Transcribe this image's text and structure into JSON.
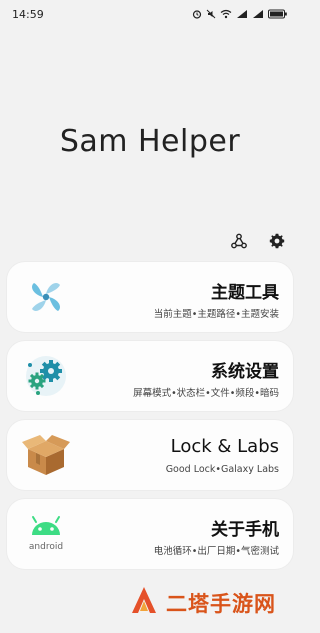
{
  "status_bar": {
    "time": "14:59",
    "battery": "100"
  },
  "app": {
    "title": "Sam Helper"
  },
  "actions": {
    "graph_icon": "share-graph-icon",
    "settings_icon": "gear-icon"
  },
  "cards": [
    {
      "title": "主题工具",
      "subtitle": "当前主题•主题路径•主题安装",
      "icon": "fan-icon"
    },
    {
      "title": "系统设置",
      "subtitle": "屏幕模式•状态栏•文件•频段•暗码",
      "icon": "gears-icon"
    },
    {
      "title": "Lock & Labs",
      "subtitle": "Good Lock•Galaxy Labs",
      "icon": "box-icon"
    },
    {
      "title": "关于手机",
      "subtitle": "电池循环•出厂日期•气密测试",
      "icon": "android-icon",
      "icon_text": "android"
    }
  ],
  "watermark": {
    "text": "二塔手游网"
  }
}
